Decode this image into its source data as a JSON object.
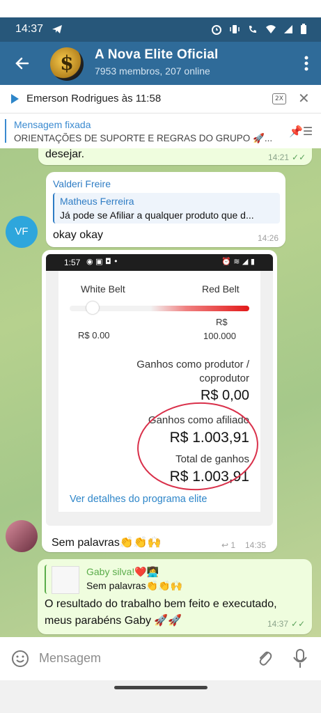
{
  "status_bar": {
    "time": "14:37"
  },
  "header": {
    "title": "A Nova Elite Oficial",
    "subtitle": "7953 membros, 207 online",
    "avatar_glyph": "$"
  },
  "audio_bar": {
    "sender_time": "Emerson Rodrigues às 11:58",
    "speed": "2X"
  },
  "pinned": {
    "label": "Mensagem fixada",
    "text": "ORIENTAÇÕES DE SUPORTE E REGRAS DO GRUPO 🚀..."
  },
  "messages": {
    "m1": {
      "text": "desejar.",
      "time": "14:21"
    },
    "m2": {
      "sender": "Valderi Freire",
      "reply_name": "Matheus Ferreira",
      "reply_text": "Já pode se Afiliar a qualquer produto que d...",
      "text": "okay okay",
      "time": "14:26",
      "avatar_initials": "VF"
    },
    "m3": {
      "screenshot": {
        "time": "1:57",
        "level_left": "White Belt",
        "level_right": "Red Belt",
        "value_left": "R$ 0.00",
        "value_right_1": "R$",
        "value_right_2": "100.000",
        "producer_label_1": "Ganhos como produtor /",
        "producer_label_2": "coprodutor",
        "producer_value": "R$ 0,00",
        "affiliate_label": "Ganhos como afiliado",
        "affiliate_value": "R$ 1.003,91",
        "total_label": "Total de ganhos",
        "total_value": "R$ 1.003,91",
        "link": "Ver detalhes do programa elite"
      },
      "text": "Sem palavras👏👏🙌",
      "reply_count": "1",
      "time": "14:35"
    },
    "m4": {
      "reply_name": "Gaby silva!❤️👩‍💻",
      "reply_text": "Sem palavras👏👏🙌",
      "text_line1": "O resultado do trabalho bem feito e executado,",
      "text_line2": "meus parabéns Gaby 🚀🚀",
      "time": "14:37"
    }
  },
  "input": {
    "placeholder": "Mensagem"
  },
  "colors": {
    "header": "#2f6b99",
    "status": "#27577a",
    "accent": "#2e7cc4",
    "outgoing": "#effdde"
  }
}
